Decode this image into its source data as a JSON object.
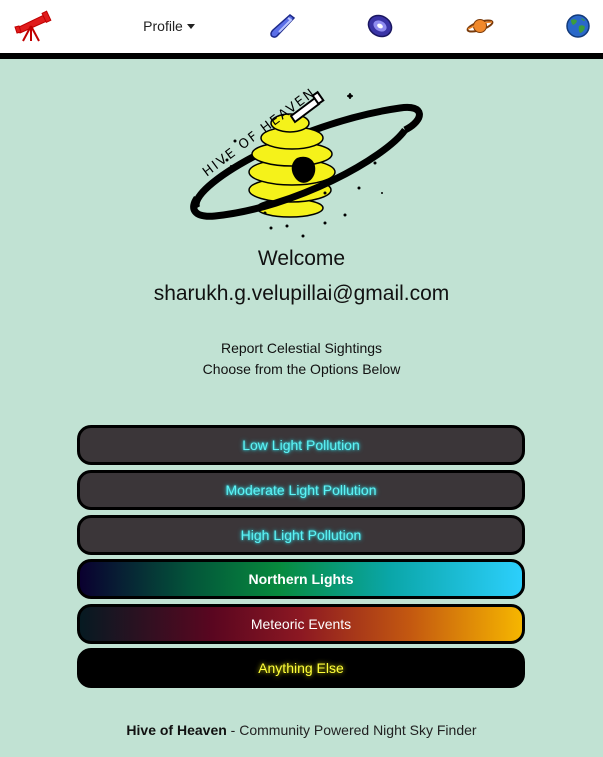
{
  "nav": {
    "telescope_icon": "telescope-icon",
    "profile_label": "Profile",
    "comet_icon": "comet-icon",
    "galaxy_icon": "galaxy-icon",
    "planet_icon": "planet-icon",
    "earth_icon": "earth-icon"
  },
  "logo": {
    "text": "HIVE OF HEAVEN"
  },
  "main": {
    "welcome": "Welcome",
    "email": "sharukh.g.velupillai@gmail.com",
    "subtitle_line1": "Report Celestial Sightings",
    "subtitle_line2": "Choose from the Options Below"
  },
  "options": [
    {
      "label": "Low Light Pollution"
    },
    {
      "label": "Moderate Light Pollution"
    },
    {
      "label": "High Light Pollution"
    },
    {
      "label": "Northern Lights"
    },
    {
      "label": "Meteoric Events"
    },
    {
      "label": "Anything Else"
    }
  ],
  "footer": {
    "brand": "Hive of Heaven",
    "tagline": " - Community Powered Night Sky Finder"
  },
  "colors": {
    "background": "#c1e2d3",
    "navbar": "#ffffff",
    "button_dark": "#3b3639",
    "button_glow_text": "#5ef3f5",
    "anything_else_text": "#ffff3a"
  }
}
